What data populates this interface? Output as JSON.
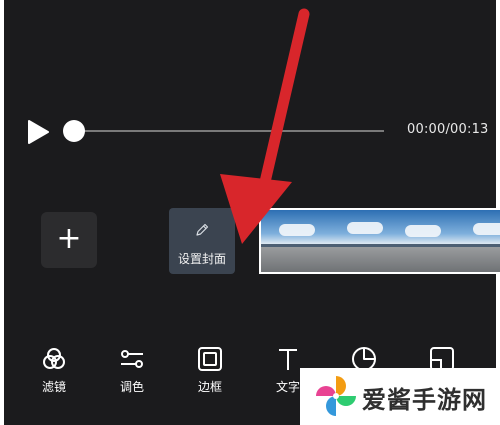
{
  "player": {
    "time": "00:00/00:13"
  },
  "timeline": {
    "add_label": "+",
    "cover_label": "设置封面"
  },
  "toolbar": {
    "items": [
      {
        "label": "滤镜",
        "icon": "filter-icon"
      },
      {
        "label": "调色",
        "icon": "adjust-icon"
      },
      {
        "label": "边框",
        "icon": "border-icon"
      },
      {
        "label": "文字",
        "icon": "text-icon"
      },
      {
        "label": "",
        "icon": "sticker-icon"
      },
      {
        "label": "",
        "icon": "crop-icon"
      }
    ]
  },
  "watermark": {
    "text": "爱酱手游网"
  },
  "colors": {
    "background": "#1b1b1d",
    "arrow": "#d8262b",
    "accent_white": "#ffffff"
  }
}
